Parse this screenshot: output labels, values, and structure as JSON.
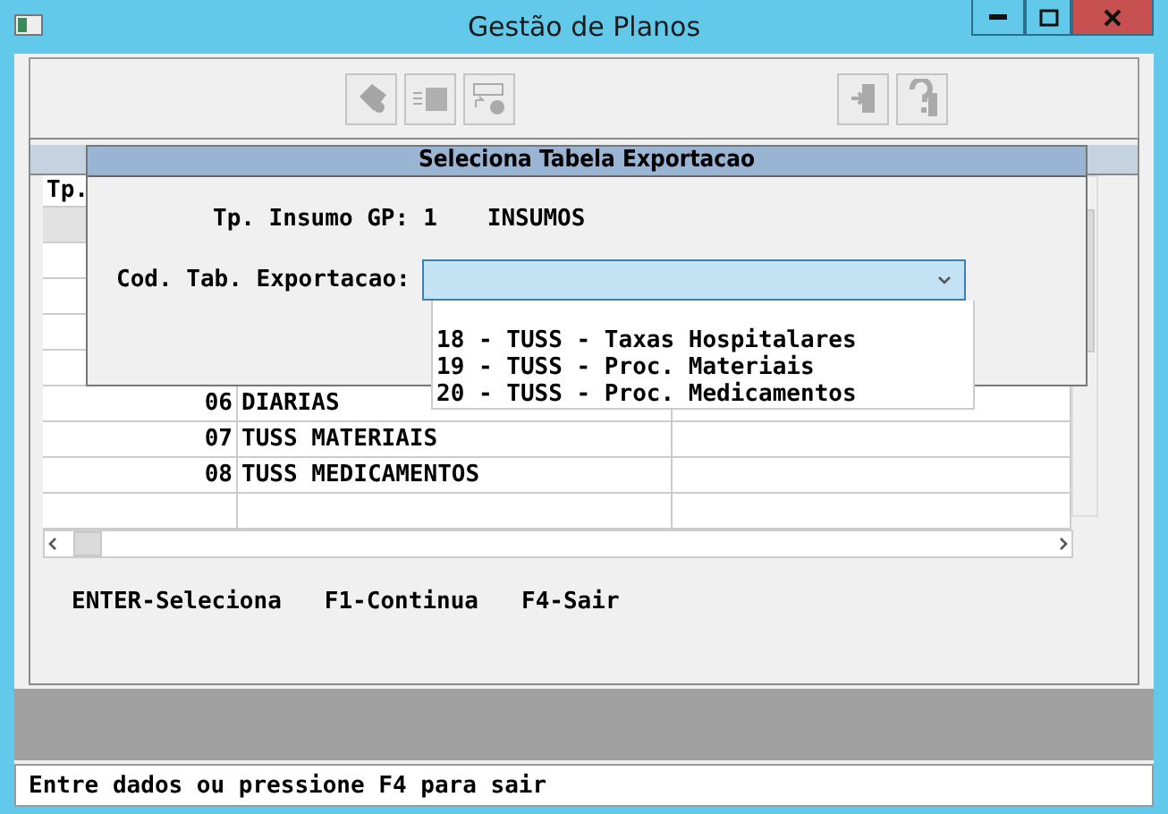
{
  "window": {
    "title": "Gestão de Planos"
  },
  "table": {
    "header": "Tp.",
    "rows": [
      {
        "selected": true
      },
      {
        "selected": false
      },
      {
        "selected": false
      },
      {
        "selected": false
      },
      {
        "selected": false
      },
      {
        "code": "06",
        "name": "DIARIAS",
        "selected": false
      },
      {
        "code": "07",
        "name": "TUSS MATERIAIS",
        "selected": false
      },
      {
        "code": "08",
        "name": "TUSS MEDICAMENTOS",
        "selected": false
      },
      {
        "selected": false
      }
    ]
  },
  "dialog": {
    "title": "Seleciona Tabela Exportacao",
    "insumo_label": "Tp. Insumo GP:",
    "insumo_code": "1",
    "insumo_name": "INSUMOS",
    "field_label": "Cod. Tab. Exportacao:",
    "dropdown": {
      "expanded": true,
      "options": [
        "18 - TUSS - Taxas Hospitalares",
        "19 - TUSS - Proc. Materiais",
        "20 - TUSS - Proc. Medicamentos"
      ]
    }
  },
  "hints": [
    "ENTER-Seleciona",
    "F1-Continua",
    "F4-Sair"
  ],
  "status": "Entre dados ou pressione F4 para sair"
}
